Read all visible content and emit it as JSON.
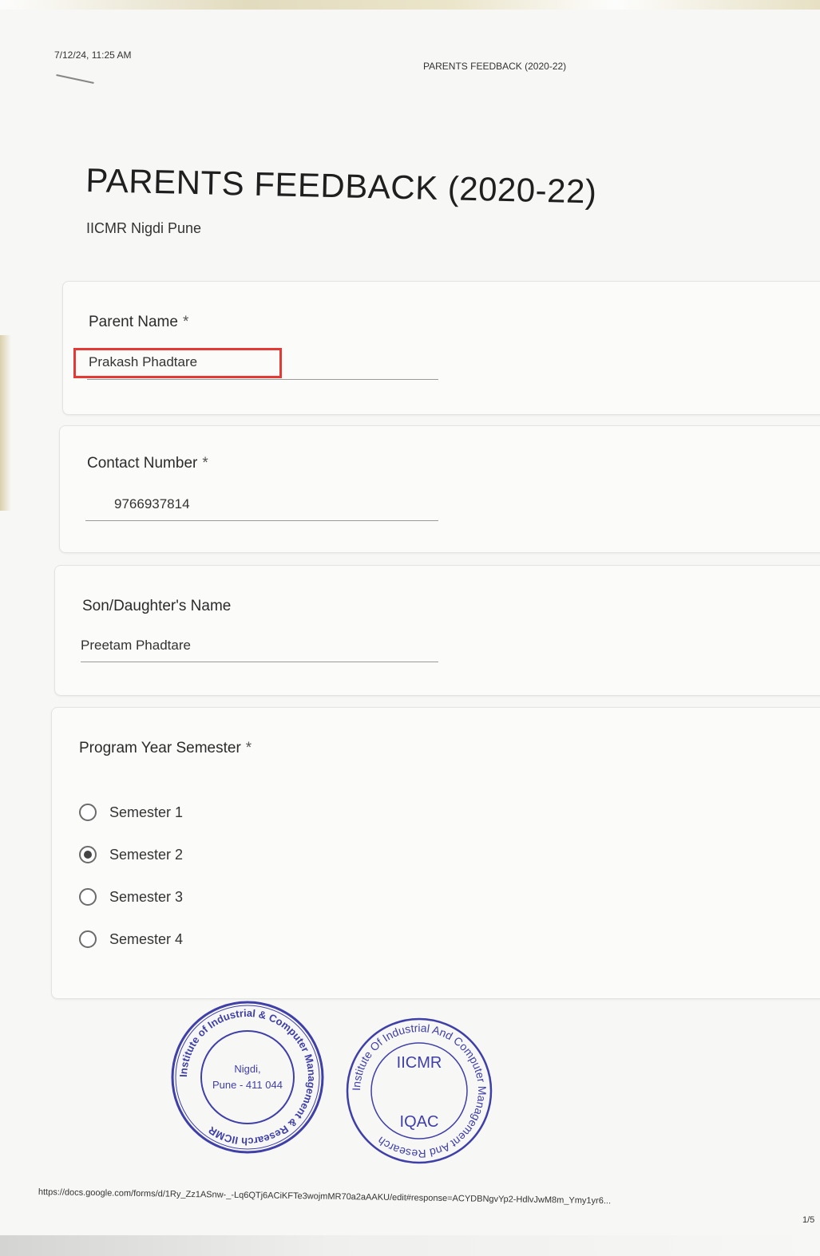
{
  "print_header": {
    "date": "7/12/24, 11:25 AM",
    "title": "PARENTS FEEDBACK (2020-22)"
  },
  "form": {
    "title": "PARENTS FEEDBACK (2020-22)",
    "subtitle": "IICMR Nigdi Pune"
  },
  "questions": [
    {
      "label": "Parent Name",
      "required_mark": "*",
      "answer": "Prakash Phadtare"
    },
    {
      "label": "Contact Number",
      "required_mark": "*",
      "answer": "9766937814"
    },
    {
      "label": "Son/Daughter's  Name",
      "required_mark": "",
      "answer": "Preetam Phadtare"
    },
    {
      "label": "Program Year Semester",
      "required_mark": "*"
    }
  ],
  "semester_options": [
    {
      "label": "Semester 1",
      "selected": false
    },
    {
      "label": "Semester 2",
      "selected": true
    },
    {
      "label": "Semester 3",
      "selected": false
    },
    {
      "label": "Semester 4",
      "selected": false
    }
  ],
  "stamps": {
    "left": {
      "ring_text": "Institute of Industrial & Computer Management & Research IICMR",
      "center_line1": "Nigdi,",
      "center_line2": "Pune - 411 044"
    },
    "right": {
      "ring_text": "Institute Of Industrial And Computer Management And Research",
      "center_top": "IICMR",
      "center_bottom": "IQAC"
    }
  },
  "footer": {
    "url": "https://docs.google.com/forms/d/1Ry_Zz1ASnw-_-Lq6QTj6ACiKFTe3wojmMR70a2aAAKU/edit#response=ACYDBNgvYp2-HdlvJwM8m_Ymy1yr6...",
    "page": "1/5"
  },
  "colors": {
    "highlight": "#e53935",
    "stamp_ink": "#3f3fa8"
  }
}
